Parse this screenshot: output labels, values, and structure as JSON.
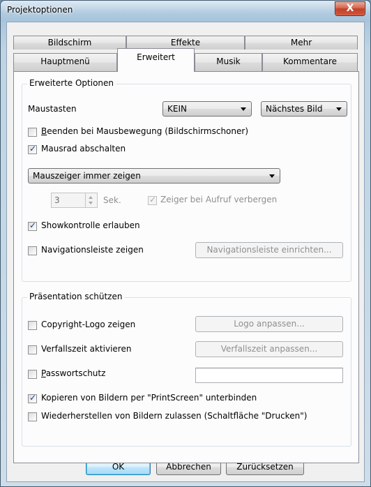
{
  "window": {
    "title": "Projektoptionen",
    "close_glyph": "X"
  },
  "tabs": {
    "row1": [
      "Bildschirm",
      "Effekte",
      "Mehr"
    ],
    "row2": [
      "Hauptmenü",
      "Erweitert",
      "Musik",
      "Kommentare"
    ],
    "active": "Erweitert"
  },
  "advanced": {
    "group_label": "Erweiterte Optionen",
    "mouse_buttons_label": "Maustasten",
    "mouse_left_value": "KEIN",
    "mouse_right_value": "Nächstes Bild",
    "exit_on_mouse_move": {
      "label": "Beenden bei Mausbewegung (Bildschirmschoner)",
      "checked": false
    },
    "disable_mouse_wheel": {
      "label": "Mausrad abschalten",
      "checked": true
    },
    "mouse_pointer_mode": "Mauszeiger immer zeigen",
    "seconds_value": "3",
    "seconds_unit": "Sek.",
    "hide_pointer_on_call": {
      "label": "Zeiger bei Aufruf verbergen",
      "checked": true,
      "disabled": true
    },
    "allow_show_control": {
      "label": "Showkontrolle erlauben",
      "checked": true
    },
    "show_nav_bar": {
      "label": "Navigationsleiste zeigen",
      "checked": false
    },
    "setup_nav_bar_button": "Navigationsleiste einrichten..."
  },
  "protect": {
    "group_label": "Präsentation schützen",
    "copyright_logo": {
      "label": "Copyright-Logo zeigen",
      "checked": false
    },
    "adjust_logo_button": "Logo anpassen...",
    "expiry": {
      "label": "Verfallszeit aktivieren",
      "checked": false
    },
    "adjust_expiry_button": "Verfallszeit anpassen...",
    "password": {
      "label": "Passwortschutz",
      "checked": false
    },
    "password_value": "",
    "block_printscreen": {
      "label": "Kopieren von Bildern per \"PrintScreen\" unterbinden",
      "checked": true
    },
    "allow_restore": {
      "label": "Wiederherstellen von Bildern zulassen (Schaltfläche \"Drucken\")",
      "checked": false
    }
  },
  "footer": {
    "ok": "OK",
    "cancel": "Abbrechen",
    "reset": "Zurücksetzen"
  }
}
